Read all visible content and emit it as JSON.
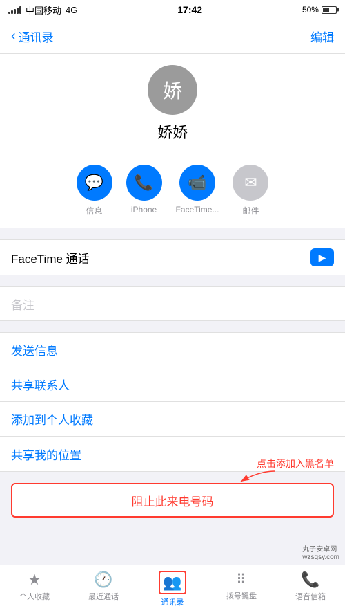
{
  "statusBar": {
    "carrier": "中国移动",
    "networkType": "4G",
    "time": "17:42",
    "batteryPercent": "50%"
  },
  "navBar": {
    "backLabel": "通讯录",
    "editLabel": "编辑"
  },
  "contact": {
    "avatarChar": "娇",
    "name": "娇娇"
  },
  "actions": [
    {
      "icon": "💬",
      "label": "信息",
      "type": "blue"
    },
    {
      "icon": "📞",
      "label": "iPhone",
      "type": "blue"
    },
    {
      "icon": "📹",
      "label": "FaceTime...",
      "type": "blue"
    },
    {
      "icon": "✉",
      "label": "邮件",
      "type": "gray"
    }
  ],
  "facetimeSection": {
    "label": "FaceTime 通话"
  },
  "notePlaceholder": "备注",
  "actionListItems": [
    {
      "label": "发送信息"
    },
    {
      "label": "共享联系人"
    },
    {
      "label": "添加到个人收藏"
    },
    {
      "label": "共享我的位置"
    }
  ],
  "blockSection": {
    "label": "阻止此来电号码",
    "annotationText": "点击添加入黑名单"
  },
  "tabBar": {
    "items": [
      {
        "icon": "★",
        "label": "个人收藏",
        "active": false
      },
      {
        "icon": "🕐",
        "label": "最近通话",
        "active": false
      },
      {
        "icon": "👥",
        "label": "通讯录",
        "active": true
      },
      {
        "icon": "⠿",
        "label": "拨号键盘",
        "active": false
      },
      {
        "icon": "📞",
        "label": "语音信箱",
        "active": false
      }
    ]
  },
  "watermark": "丸子安卓网\nwzsqsy.com"
}
